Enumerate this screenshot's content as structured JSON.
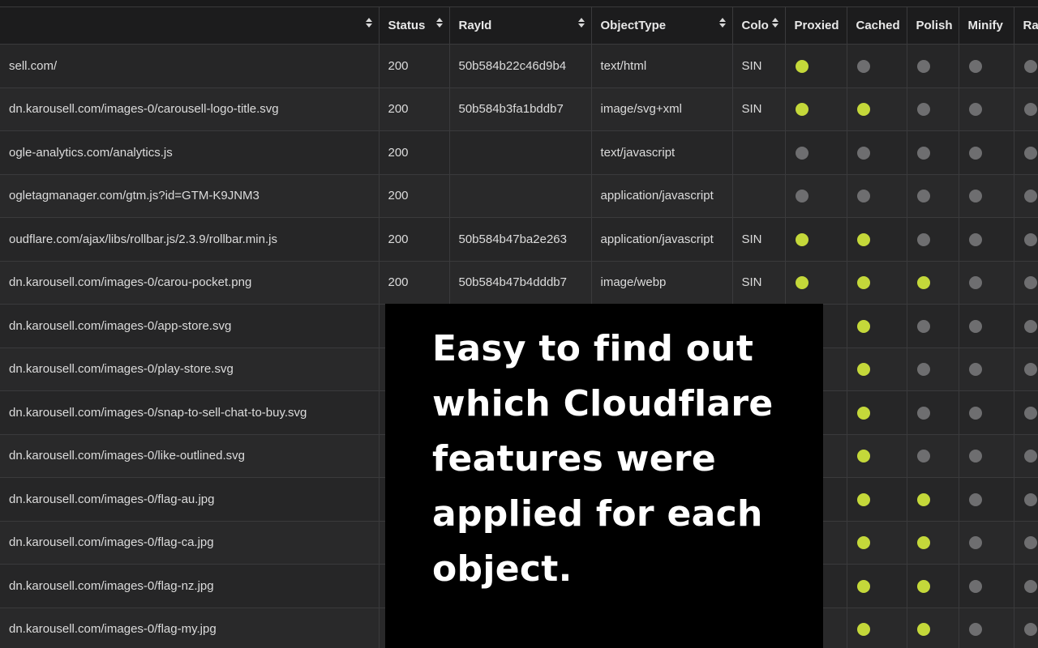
{
  "colors": {
    "dot_on": "#c4d83a",
    "dot_off": "#6e6e70",
    "overlay_bg": "#000000"
  },
  "columns": [
    "",
    "Status",
    "RayId",
    "ObjectType",
    "Colo",
    "Proxied",
    "Cached",
    "Polish",
    "Minify",
    "Ra"
  ],
  "rows": [
    {
      "url": "sell.com/",
      "status": "200",
      "rayid": "50b584b22c46d9b4",
      "type": "text/html",
      "colo": "SIN",
      "flags": [
        true,
        false,
        false,
        false,
        false
      ]
    },
    {
      "url": "dn.karousell.com/images-0/carousell-logo-title.svg",
      "status": "200",
      "rayid": "50b584b3fa1bddb7",
      "type": "image/svg+xml",
      "colo": "SIN",
      "flags": [
        true,
        true,
        false,
        false,
        false
      ]
    },
    {
      "url": "ogle-analytics.com/analytics.js",
      "status": "200",
      "rayid": "",
      "type": "text/javascript",
      "colo": "",
      "flags": [
        false,
        false,
        false,
        false,
        false
      ]
    },
    {
      "url": "ogletagmanager.com/gtm.js?id=GTM-K9JNM3",
      "status": "200",
      "rayid": "",
      "type": "application/javascript",
      "colo": "",
      "flags": [
        false,
        false,
        false,
        false,
        false
      ]
    },
    {
      "url": "oudflare.com/ajax/libs/rollbar.js/2.3.9/rollbar.min.js",
      "status": "200",
      "rayid": "50b584b47ba2e263",
      "type": "application/javascript",
      "colo": "SIN",
      "flags": [
        true,
        true,
        false,
        false,
        false
      ]
    },
    {
      "url": "dn.karousell.com/images-0/carou-pocket.png",
      "status": "200",
      "rayid": "50b584b47b4dddb7",
      "type": "image/webp",
      "colo": "SIN",
      "flags": [
        true,
        true,
        true,
        false,
        false
      ]
    },
    {
      "url": "dn.karousell.com/images-0/app-store.svg",
      "status": "",
      "rayid": "",
      "type": "",
      "colo": "",
      "flags": [
        null,
        true,
        false,
        false,
        false
      ]
    },
    {
      "url": "dn.karousell.com/images-0/play-store.svg",
      "status": "",
      "rayid": "",
      "type": "",
      "colo": "",
      "flags": [
        null,
        true,
        false,
        false,
        false
      ]
    },
    {
      "url": "dn.karousell.com/images-0/snap-to-sell-chat-to-buy.svg",
      "status": "",
      "rayid": "",
      "type": "",
      "colo": "",
      "flags": [
        null,
        true,
        false,
        false,
        false
      ]
    },
    {
      "url": "dn.karousell.com/images-0/like-outlined.svg",
      "status": "",
      "rayid": "",
      "type": "",
      "colo": "",
      "flags": [
        null,
        true,
        false,
        false,
        false
      ]
    },
    {
      "url": "dn.karousell.com/images-0/flag-au.jpg",
      "status": "",
      "rayid": "",
      "type": "",
      "colo": "",
      "flags": [
        null,
        true,
        true,
        false,
        false
      ]
    },
    {
      "url": "dn.karousell.com/images-0/flag-ca.jpg",
      "status": "",
      "rayid": "",
      "type": "",
      "colo": "",
      "flags": [
        null,
        true,
        true,
        false,
        false
      ]
    },
    {
      "url": "dn.karousell.com/images-0/flag-nz.jpg",
      "status": "",
      "rayid": "",
      "type": "",
      "colo": "",
      "flags": [
        null,
        true,
        true,
        false,
        false
      ]
    },
    {
      "url": "dn.karousell.com/images-0/flag-my.jpg",
      "status": "",
      "rayid": "",
      "type": "",
      "colo": "",
      "flags": [
        null,
        true,
        true,
        false,
        false
      ]
    }
  ],
  "overlay": {
    "caption": "Easy to find out which Cloudflare features were applied for each object."
  }
}
